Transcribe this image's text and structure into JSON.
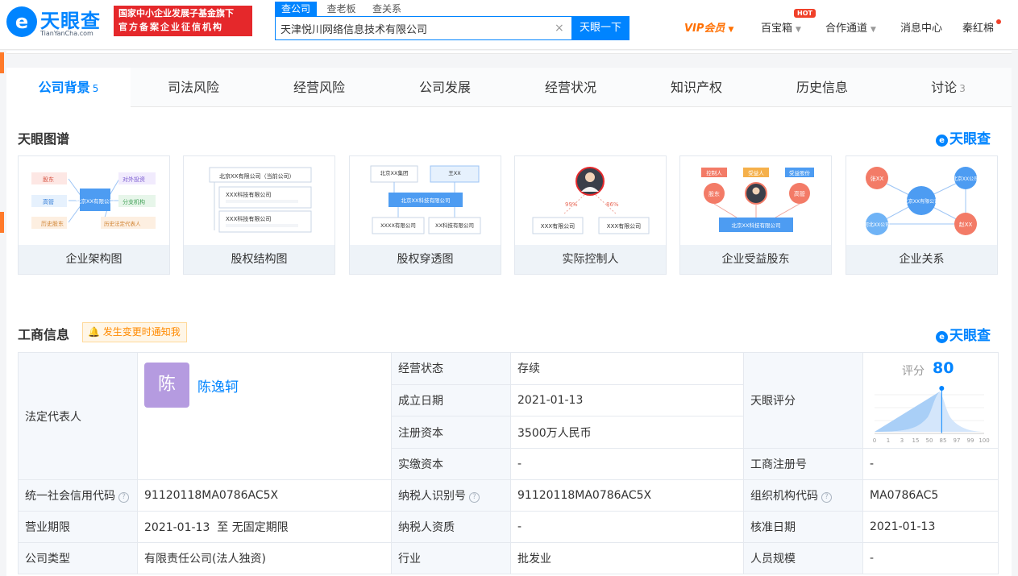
{
  "header": {
    "logo_name": "天眼查",
    "logo_domain": "TianYanCha.com",
    "logo_mark": "e",
    "badge_line1": "国家中小企业发展子基金旗下",
    "badge_line2": "官方备案企业征信机构",
    "search_tabs": [
      "查公司",
      "查老板",
      "查关系"
    ],
    "search_value": "天津悦川网络信息技术有限公司",
    "search_clear": "×",
    "search_button": "天眼一下",
    "nav": {
      "vip": "VIP会员",
      "baobao": "百宝箱",
      "hot": "HOT",
      "partner": "合作通道",
      "messages": "消息中心",
      "user": "秦红棉"
    }
  },
  "tabs": [
    {
      "label": "公司背景",
      "count": "5"
    },
    {
      "label": "司法风险",
      "count": ""
    },
    {
      "label": "经营风险",
      "count": ""
    },
    {
      "label": "公司发展",
      "count": ""
    },
    {
      "label": "经营状况",
      "count": ""
    },
    {
      "label": "知识产权",
      "count": ""
    },
    {
      "label": "历史信息",
      "count": ""
    },
    {
      "label": "讨论",
      "count": "3"
    }
  ],
  "graph_section": {
    "title": "天眼图谱",
    "brand": "天眼查",
    "cards": [
      {
        "caption": "企业架构图"
      },
      {
        "caption": "股权结构图"
      },
      {
        "caption": "股权穿透图"
      },
      {
        "caption": "实际控制人"
      },
      {
        "caption": "企业受益股东"
      },
      {
        "caption": "企业关系"
      }
    ],
    "thumb1": {
      "center": "北京XX有限公司",
      "l1": "股东",
      "l2": "高管",
      "l3": "历史股东",
      "r1": "对外投资",
      "r2": "分支机构",
      "r3": "历史法定代表人"
    },
    "thumb2": {
      "top": "北京XX有限公司（当前公司）",
      "c1": "XXX科技有限公司",
      "c2": "XXX科技有限公司"
    },
    "thumb3": {
      "t1": "北京XX集团",
      "t2": "王XX",
      "mid": "北京XX科技有限公司",
      "b1": "XXXX有限公司",
      "b2": "XX科技有限公司"
    },
    "thumb4": {
      "p1": "99%",
      "p2": "86%",
      "b1": "XXX有限公司",
      "b2": "XXX有限公司"
    },
    "thumb5": {
      "t1": "控制人",
      "t2": "受益人",
      "t3": "受益股份",
      "n1": "股东",
      "n3": "高管",
      "bottom": "北京XX科技有限公司"
    },
    "thumb6": {
      "n1": "张XX",
      "n2": "北京XX公司",
      "center": "北京XX有限公司",
      "n3": "河北XX公司",
      "n4": "赵XX"
    }
  },
  "business_section": {
    "title": "工商信息",
    "notify": "发生变更时通知我",
    "brand": "天眼查",
    "legal_rep_label": "法定代表人",
    "legal_rep_avatar": "陈",
    "legal_rep_name": "陈逸轲",
    "status_label": "经营状态",
    "status_value": "存续",
    "founded_label": "成立日期",
    "founded_value": "2021-01-13",
    "reg_capital_label": "注册资本",
    "reg_capital_value": "3500万人民币",
    "paid_capital_label": "实缴资本",
    "paid_capital_value": "-",
    "score_label": "天眼评分",
    "score_prefix": "评分",
    "score_value": "80",
    "score_level": 0.8,
    "score_ticks": [
      "0",
      "1",
      "3",
      "15",
      "50",
      "85",
      "97",
      "99",
      "100"
    ],
    "reg_no_label": "工商注册号",
    "reg_no_value": "-",
    "credit_code_label": "统一社会信用代码",
    "credit_code_value": "91120118MA0786AC5X",
    "taxpayer_id_label": "纳税人识别号",
    "taxpayer_id_value": "91120118MA0786AC5X",
    "org_code_label": "组织机构代码",
    "org_code_value": "MA0786AC5",
    "term_label": "营业期限",
    "term_value": "2021-01-13  至 无固定期限",
    "taxpayer_qual_label": "纳税人资质",
    "taxpayer_qual_value": "-",
    "approval_label": "核准日期",
    "approval_value": "2021-01-13",
    "type_label": "公司类型",
    "type_value": "有限责任公司(法人独资)",
    "industry_label": "行业",
    "industry_value": "批发业",
    "staff_label": "人员规模",
    "staff_value": "-"
  },
  "colors": {
    "brand": "#0084ff",
    "vip": "#ff6f00",
    "badge": "#e5282b",
    "avatar": "#b59be0"
  }
}
